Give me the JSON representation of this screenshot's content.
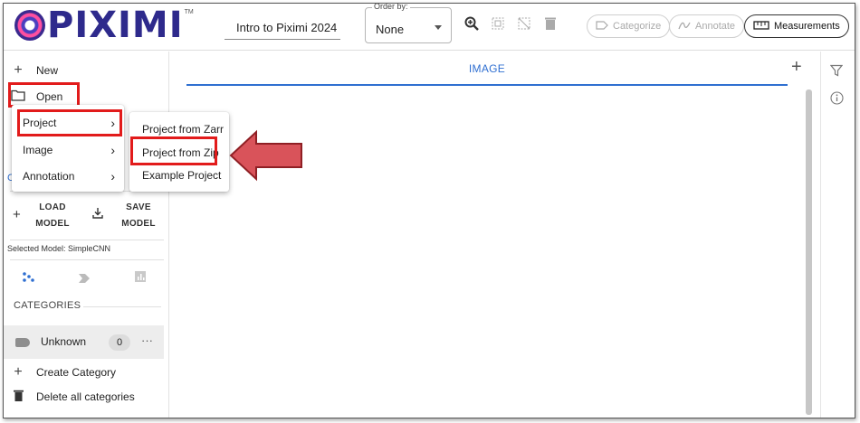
{
  "app": {
    "logo_text": "PIXIMI",
    "logo_tm": "TM",
    "project_name": "Intro to Piximi 2024"
  },
  "toolbar": {
    "orderby_label": "Order by:",
    "orderby_value": "None",
    "categorize_label": "Categorize",
    "annotate_label": "Annotate",
    "measurements_label": "Measurements"
  },
  "sidebar": {
    "new_label": "New",
    "open_label": "Open",
    "load_model_line1": "LOAD",
    "load_model_line2": "MODEL",
    "save_model_line1": "SAVE",
    "save_model_line2": "MODEL",
    "selected_model": "Selected Model: SimpleCNN",
    "categories_title": "CATEGORIES",
    "category": {
      "name": "Unknown",
      "count": "0",
      "more": "···"
    },
    "create_category": "Create Category",
    "delete_categories": "Delete all categories"
  },
  "open_menu": {
    "items": [
      {
        "label": "Project"
      },
      {
        "label": "Image"
      },
      {
        "label": "Annotation"
      }
    ]
  },
  "project_submenu": {
    "items": [
      {
        "label": "Project from Zarr"
      },
      {
        "label": "Project from Zip"
      },
      {
        "label": "Example Project"
      }
    ]
  },
  "main": {
    "tab_label": "IMAGE"
  },
  "colors": {
    "accent": "#2f6fd1",
    "highlight": "#e21b1b",
    "arrow": "#d9535a"
  }
}
